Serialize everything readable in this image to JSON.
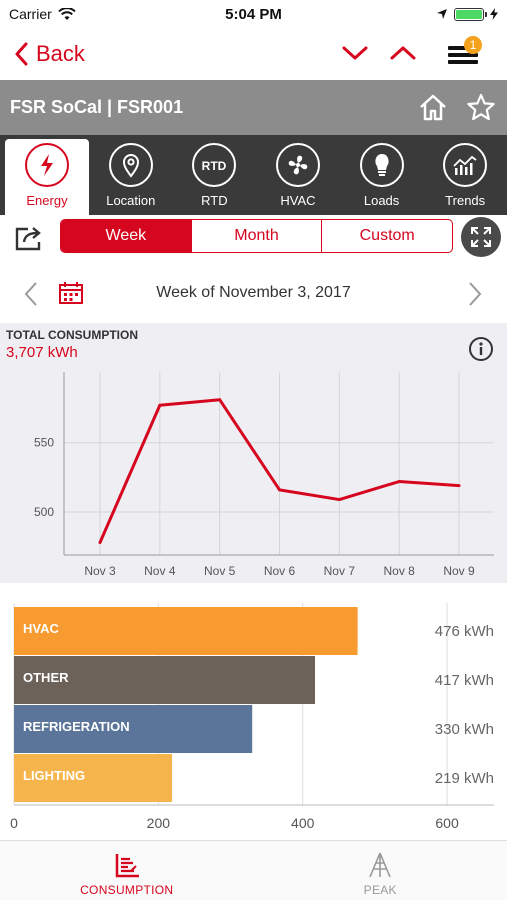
{
  "status": {
    "carrier": "Carrier",
    "time": "5:04 PM"
  },
  "nav": {
    "back_label": "Back",
    "badge": "1"
  },
  "header": {
    "title": "FSR SoCal | FSR001"
  },
  "tabs": [
    {
      "label": "Energy",
      "icon": "bolt-icon"
    },
    {
      "label": "Location",
      "icon": "map-pin-icon"
    },
    {
      "label": "RTD",
      "icon": "rtd-icon"
    },
    {
      "label": "HVAC",
      "icon": "fan-icon"
    },
    {
      "label": "Loads",
      "icon": "bulb-icon"
    },
    {
      "label": "Trends",
      "icon": "trend-chart-icon"
    }
  ],
  "period": {
    "options": [
      "Week",
      "Month",
      "Custom"
    ],
    "selected": "Week"
  },
  "week_label": "Week of November 3, 2017",
  "total": {
    "label": "TOTAL CONSUMPTION",
    "value": "3,707 kWh"
  },
  "bottom_tabs": [
    {
      "label": "CONSUMPTION"
    },
    {
      "label": "PEAK"
    }
  ],
  "colors": {
    "accent": "#d6061f",
    "hvac": "#f79a30",
    "other": "#6d6259",
    "refrigeration": "#5b7499",
    "lighting": "#f6b44d"
  },
  "chart_data": [
    {
      "type": "line",
      "title": "TOTAL CONSUMPTION",
      "categories": [
        "Nov 3",
        "Nov 4",
        "Nov 5",
        "Nov 6",
        "Nov 7",
        "Nov 8",
        "Nov 9"
      ],
      "series": [
        {
          "values": [
            478,
            577,
            581,
            516,
            509,
            522,
            519
          ]
        }
      ],
      "ylim": [
        469,
        601
      ],
      "yticks": [
        500,
        550
      ],
      "grid": true
    },
    {
      "type": "bar",
      "orientation": "horizontal",
      "categories": [
        "HVAC",
        "OTHER",
        "REFRIGERATION",
        "LIGHTING"
      ],
      "values": [
        476,
        417,
        330,
        219
      ],
      "value_labels": [
        "476 kWh",
        "417 kWh",
        "330 kWh",
        "219 kWh"
      ],
      "xlim": [
        0,
        665
      ],
      "xticks": [
        0,
        200,
        400,
        600
      ],
      "grid": true
    }
  ]
}
